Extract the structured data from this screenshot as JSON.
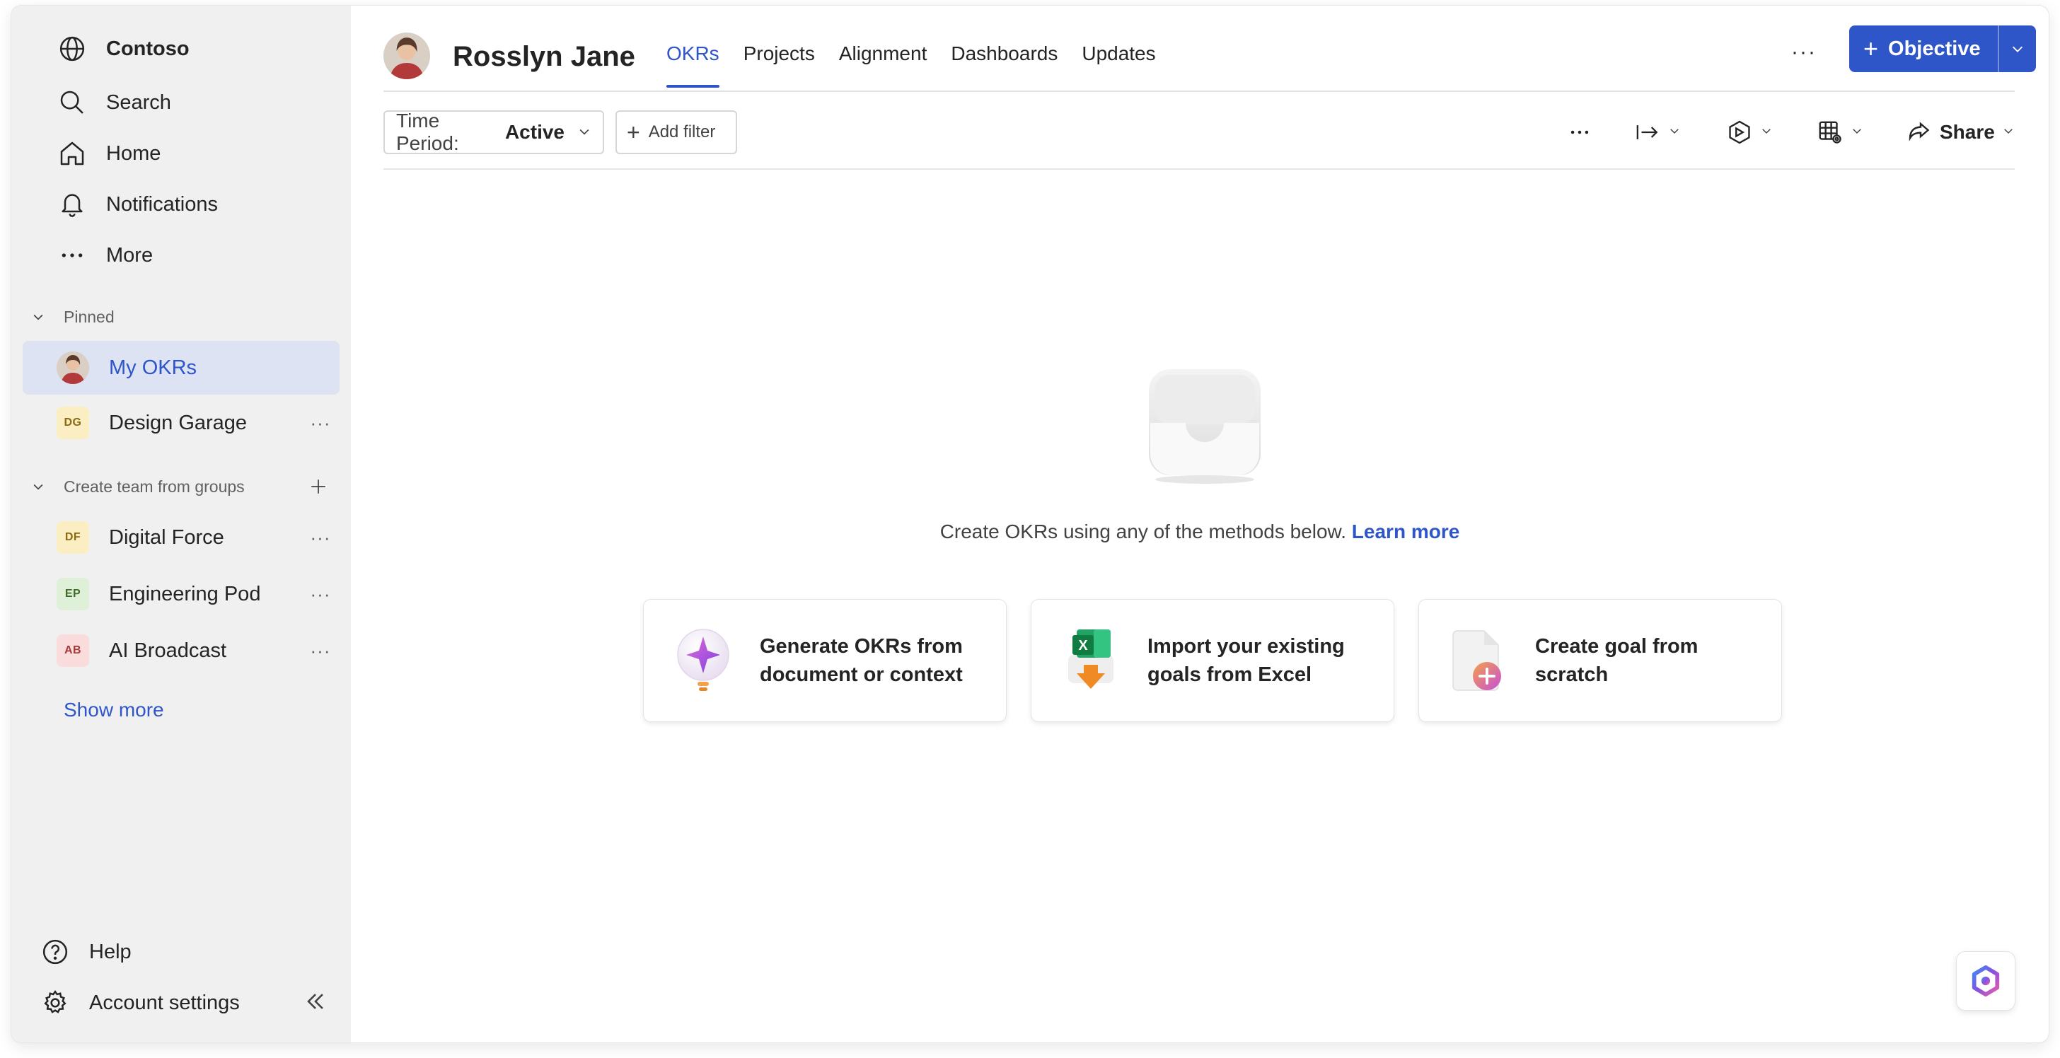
{
  "sidebar": {
    "brand": "Contoso",
    "nav": [
      {
        "label": "Search"
      },
      {
        "label": "Home"
      },
      {
        "label": "Notifications"
      },
      {
        "label": "More"
      }
    ],
    "pinned_label": "Pinned",
    "pinned": [
      {
        "label": "My OKRs",
        "initials": ""
      },
      {
        "label": "Design Garage",
        "initials": "DG"
      }
    ],
    "groups_label": "Create team from groups",
    "groups": [
      {
        "label": "Digital Force",
        "initials": "DF"
      },
      {
        "label": "Engineering Pod",
        "initials": "EP"
      },
      {
        "label": "AI Broadcast",
        "initials": "AB"
      }
    ],
    "show_more": "Show more",
    "help": "Help",
    "account_settings": "Account settings"
  },
  "header": {
    "title": "Rosslyn Jane",
    "tabs": [
      {
        "label": "OKRs",
        "active": true
      },
      {
        "label": "Projects"
      },
      {
        "label": "Alignment"
      },
      {
        "label": "Dashboards"
      },
      {
        "label": "Updates"
      }
    ],
    "objective_button": "Objective"
  },
  "toolbar": {
    "time_period_label": "Time Period:",
    "time_period_value": "Active",
    "add_filter": "Add filter",
    "share": "Share"
  },
  "empty_state": {
    "message": "Create OKRs using any of the methods below.",
    "link": "Learn more",
    "methods": [
      {
        "label": "Generate OKRs from document or context",
        "icon": "sparkle-bulb-icon"
      },
      {
        "label": "Import your existing goals from Excel",
        "icon": "excel-import-icon"
      },
      {
        "label": "Create goal from scratch",
        "icon": "new-document-icon"
      }
    ]
  },
  "colors": {
    "accent": "#2f56c9",
    "sidebar_bg": "#f0f0f0",
    "active_item_bg": "#dde3f3"
  }
}
